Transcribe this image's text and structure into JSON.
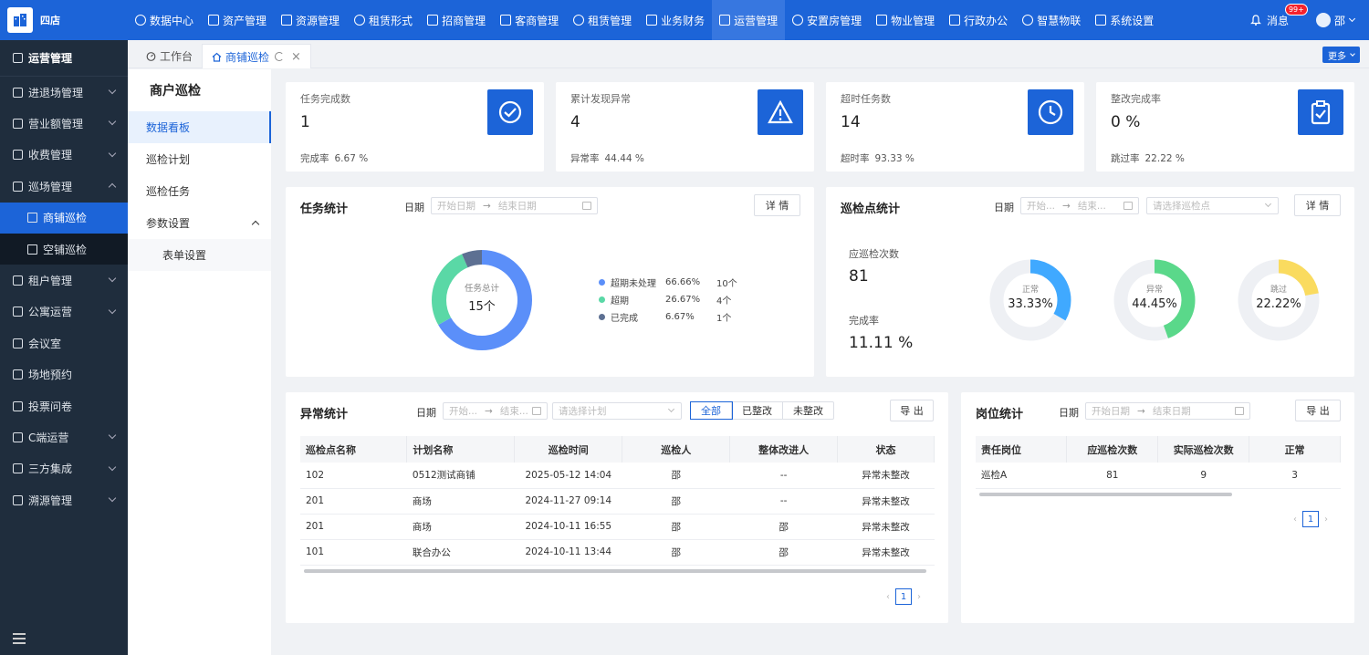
{
  "app": {
    "name": "四店"
  },
  "topnav": [
    {
      "label": "数据中心",
      "icon": "chart-icon"
    },
    {
      "label": "资产管理",
      "icon": "box-icon"
    },
    {
      "label": "资源管理",
      "icon": "building-icon"
    },
    {
      "label": "租赁形式",
      "icon": "grid-icon"
    },
    {
      "label": "招商管理",
      "icon": "tag-icon"
    },
    {
      "label": "客商管理",
      "icon": "users-icon"
    },
    {
      "label": "租赁管理",
      "icon": "home-icon"
    },
    {
      "label": "业务财务",
      "icon": "coin-icon"
    },
    {
      "label": "运营管理",
      "icon": "ops-icon"
    },
    {
      "label": "安置房管理",
      "icon": "house-icon"
    },
    {
      "label": "物业管理",
      "icon": "home-icon"
    },
    {
      "label": "行政办公",
      "icon": "monitor-icon"
    },
    {
      "label": "智慧物联",
      "icon": "iot-icon"
    },
    {
      "label": "系统设置",
      "icon": "gear-icon"
    }
  ],
  "topright": {
    "messages": "消息",
    "badge": "99+",
    "user": "邵"
  },
  "sidebar": {
    "header": "运营管理",
    "items": [
      {
        "label": "进退场管理",
        "chev": "down"
      },
      {
        "label": "营业额管理",
        "chev": "down"
      },
      {
        "label": "收费管理",
        "chev": "down"
      },
      {
        "label": "巡场管理",
        "chev": "up"
      },
      {
        "label": "商铺巡检",
        "sub": true,
        "active": true
      },
      {
        "label": "空铺巡检",
        "sub": true
      },
      {
        "label": "租户管理",
        "chev": "down"
      },
      {
        "label": "公寓运营",
        "chev": "down"
      },
      {
        "label": "会议室"
      },
      {
        "label": "场地预约"
      },
      {
        "label": "投票问卷"
      },
      {
        "label": "C端运营",
        "chev": "down"
      },
      {
        "label": "三方集成",
        "chev": "down"
      },
      {
        "label": "溯源管理",
        "chev": "down"
      }
    ]
  },
  "tabs": {
    "home": "工作台",
    "current": "商铺巡检",
    "more": "更多"
  },
  "subside": {
    "title": "商户巡检",
    "items": [
      {
        "label": "数据看板",
        "active": true
      },
      {
        "label": "巡检计划"
      },
      {
        "label": "巡检任务"
      },
      {
        "label": "参数设置",
        "chev": "up"
      },
      {
        "label": "表单设置",
        "child": true
      }
    ]
  },
  "kpis": [
    {
      "label": "任务完成数",
      "value": "1",
      "foot_label": "完成率",
      "foot_value": "6.67 %",
      "icon": "check-clock-icon"
    },
    {
      "label": "累计发现异常",
      "value": "4",
      "foot_label": "异常率",
      "foot_value": "44.44 %",
      "icon": "warning-icon"
    },
    {
      "label": "超时任务数",
      "value": "14",
      "foot_label": "超时率",
      "foot_value": "93.33 %",
      "icon": "clock-icon"
    },
    {
      "label": "整改完成率",
      "value": "0 %",
      "foot_label": "跳过率",
      "foot_value": "22.22 %",
      "icon": "clipboard-check-icon"
    }
  ],
  "task_stats": {
    "title": "任务统计",
    "date_label": "日期",
    "start_placeholder": "开始日期",
    "end_placeholder": "结束日期",
    "detail": "详 情",
    "center_label": "任务总计",
    "center_value": "15个"
  },
  "point_stats": {
    "title": "巡检点统计",
    "date_label": "日期",
    "start_placeholder": "开始...",
    "end_placeholder": "结束...",
    "select_placeholder": "请选择巡检点",
    "detail": "详 情",
    "should_label": "应巡检次数",
    "should_value": "81",
    "rate_label": "完成率",
    "rate_value": "11.11 %"
  },
  "abnormal": {
    "title": "异常统计",
    "date_label": "日期",
    "start_placeholder": "开始...",
    "end_placeholder": "结束...",
    "plan_placeholder": "请选择计划",
    "filters": [
      "全部",
      "已整改",
      "未整改"
    ],
    "export": "导 出",
    "columns": [
      "巡检点名称",
      "计划名称",
      "巡检时间",
      "巡检人",
      "整体改进人",
      "状态"
    ],
    "rows": [
      [
        "102",
        "0512测试商铺",
        "2025-05-12 14:04",
        "邵",
        "--",
        "异常未整改"
      ],
      [
        "201",
        "商场",
        "2024-11-27 09:14",
        "邵",
        "--",
        "异常未整改"
      ],
      [
        "201",
        "商场",
        "2024-10-11 16:55",
        "邵",
        "邵",
        "异常未整改"
      ],
      [
        "101",
        "联合办公",
        "2024-10-11 13:44",
        "邵",
        "邵",
        "异常未整改"
      ]
    ],
    "page": "1"
  },
  "post": {
    "title": "岗位统计",
    "date_label": "日期",
    "start_placeholder": "开始日期",
    "end_placeholder": "结束日期",
    "export": "导 出",
    "columns": [
      "责任岗位",
      "应巡检次数",
      "实际巡检次数",
      "正常"
    ],
    "rows": [
      [
        "巡检A",
        "81",
        "9",
        "3"
      ]
    ],
    "page": "1"
  },
  "chart_data": [
    {
      "type": "pie",
      "title": "任务统计",
      "categories": [
        "超期未处理",
        "超期",
        "已完成"
      ],
      "values": [
        66.66,
        26.67,
        6.67
      ],
      "counts": [
        "10个",
        "4个",
        "1个"
      ],
      "colors": [
        "#5b8ff9",
        "#5ad8a6",
        "#5d7092"
      ],
      "center_label": "任务总计",
      "center_value": "15个"
    },
    {
      "type": "pie",
      "categories": [
        "正常"
      ],
      "values": [
        33.33
      ],
      "label": "33.33%",
      "color": "#40a9ff"
    },
    {
      "type": "pie",
      "categories": [
        "异常"
      ],
      "values": [
        44.45
      ],
      "label": "44.45%",
      "color": "#5ad88a"
    },
    {
      "type": "pie",
      "categories": [
        "跳过"
      ],
      "values": [
        22.22
      ],
      "label": "22.22%",
      "color": "#fadb5f"
    }
  ],
  "colors": {
    "primary": "#1c64d8",
    "sidebar": "#1f2d3d"
  }
}
